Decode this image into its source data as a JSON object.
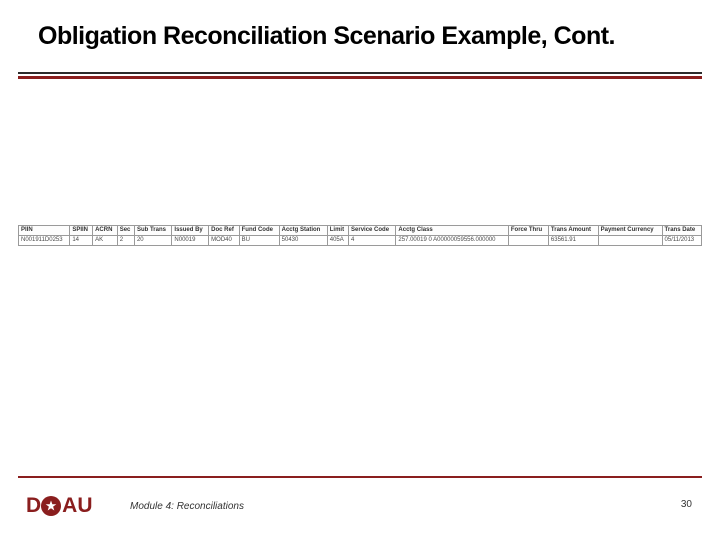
{
  "title": "Obligation Reconciliation Scenario Example, Cont.",
  "footer": {
    "module_label": "Module 4: Reconciliations",
    "page_number": "30",
    "logo_d": "D",
    "logo_au": "AU"
  },
  "table": {
    "headers": [
      "PIIN",
      "SPIIN",
      "ACRN",
      "Sec",
      "Sub Trans",
      "Issued By",
      "Doc Ref",
      "Fund Code",
      "Acctg Station",
      "Limit",
      "Service Code",
      "Acctg Class",
      "Force Thru",
      "Trans Amount",
      "Payment Currency",
      "Trans Date"
    ],
    "row": [
      "N001911D0253",
      "14",
      "AK",
      "2",
      "20",
      "N00019",
      "MOD40",
      "BU",
      "50430",
      "405A",
      "4",
      "257.00019 0 A00000059556.000000",
      "",
      "63561.91",
      "",
      "05/11/2013"
    ]
  },
  "chart_data": {
    "type": "table",
    "title": "Obligation Reconciliation Scenario Example, Cont.",
    "columns": [
      "PIIN",
      "SPIIN",
      "ACRN",
      "Sec",
      "Sub Trans",
      "Issued By",
      "Doc Ref",
      "Fund Code",
      "Acctg Station",
      "Limit",
      "Service Code",
      "Acctg Class",
      "Force Thru",
      "Trans Amount",
      "Payment Currency",
      "Trans Date"
    ],
    "rows": [
      [
        "N001911D0253",
        "14",
        "AK",
        "2",
        "20",
        "N00019",
        "MOD40",
        "BU",
        "50430",
        "405A",
        "4",
        "257.00019 0 A00000059556.000000",
        "",
        "63561.91",
        "",
        "05/11/2013"
      ]
    ]
  }
}
